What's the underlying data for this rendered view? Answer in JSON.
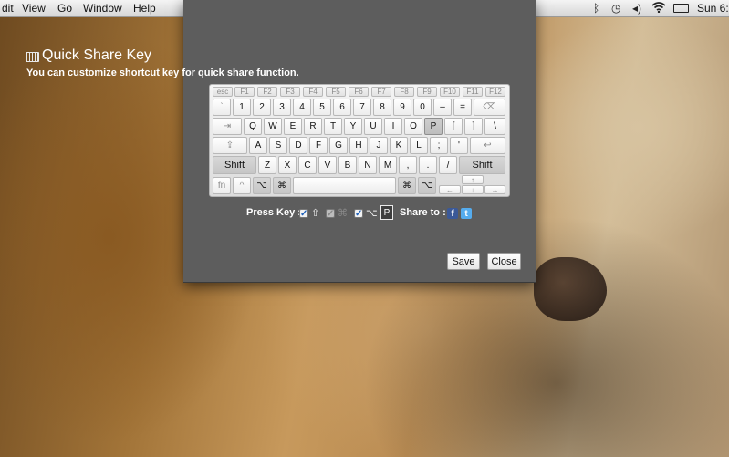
{
  "menubar": {
    "menus": [
      "dit",
      "View",
      "Go",
      "Window",
      "Help"
    ],
    "clock": "Sun 6:"
  },
  "status_icons": [
    "bluetooth-icon",
    "time-machine-icon",
    "volume-icon",
    "wifi-icon",
    "battery-icon"
  ],
  "dialog": {
    "title": "Quick Share Key",
    "subtitle": "You can customize shortcut key for quick share function.",
    "press_key_label": "Press Key :",
    "modifiers": [
      {
        "symbol": "⇧",
        "checked": true
      },
      {
        "symbol": "⌘",
        "checked": false
      },
      {
        "symbol": "⌥",
        "checked": true
      }
    ],
    "selected_key": "P",
    "share_to_label": "Share to :",
    "share_targets": [
      "facebook-icon",
      "twitter-icon"
    ],
    "save_label": "Save",
    "close_label": "Close"
  },
  "keyboard": {
    "function_row": [
      "esc",
      "F1",
      "F2",
      "F3",
      "F4",
      "F5",
      "F6",
      "F7",
      "F8",
      "F9",
      "F10",
      "F11",
      "F12"
    ],
    "number_row": [
      "`",
      "1",
      "2",
      "3",
      "4",
      "5",
      "6",
      "7",
      "8",
      "9",
      "0",
      "–",
      "=",
      "⌫"
    ],
    "q_row": [
      "⇥",
      "Q",
      "W",
      "E",
      "R",
      "T",
      "Y",
      "U",
      "I",
      "O",
      "P",
      "[",
      "]",
      "\\"
    ],
    "a_row": [
      "⇪",
      "A",
      "S",
      "D",
      "F",
      "G",
      "H",
      "J",
      "K",
      "L",
      ";",
      "'",
      "↩"
    ],
    "z_row": [
      "Shift",
      "Z",
      "X",
      "C",
      "V",
      "B",
      "N",
      "M",
      ",",
      ".",
      "/",
      "Shift"
    ],
    "bottom_row": [
      "fn",
      "^",
      "⌥",
      "⌘",
      "",
      "⌘",
      "⌥"
    ],
    "arrows": [
      "↑",
      "←",
      "↓",
      "→"
    ]
  },
  "colors": {
    "dialog_bg": "#5d5d5d",
    "facebook": "#3b5998",
    "twitter": "#55acee",
    "checkbox_check": "#1d5fb8"
  }
}
